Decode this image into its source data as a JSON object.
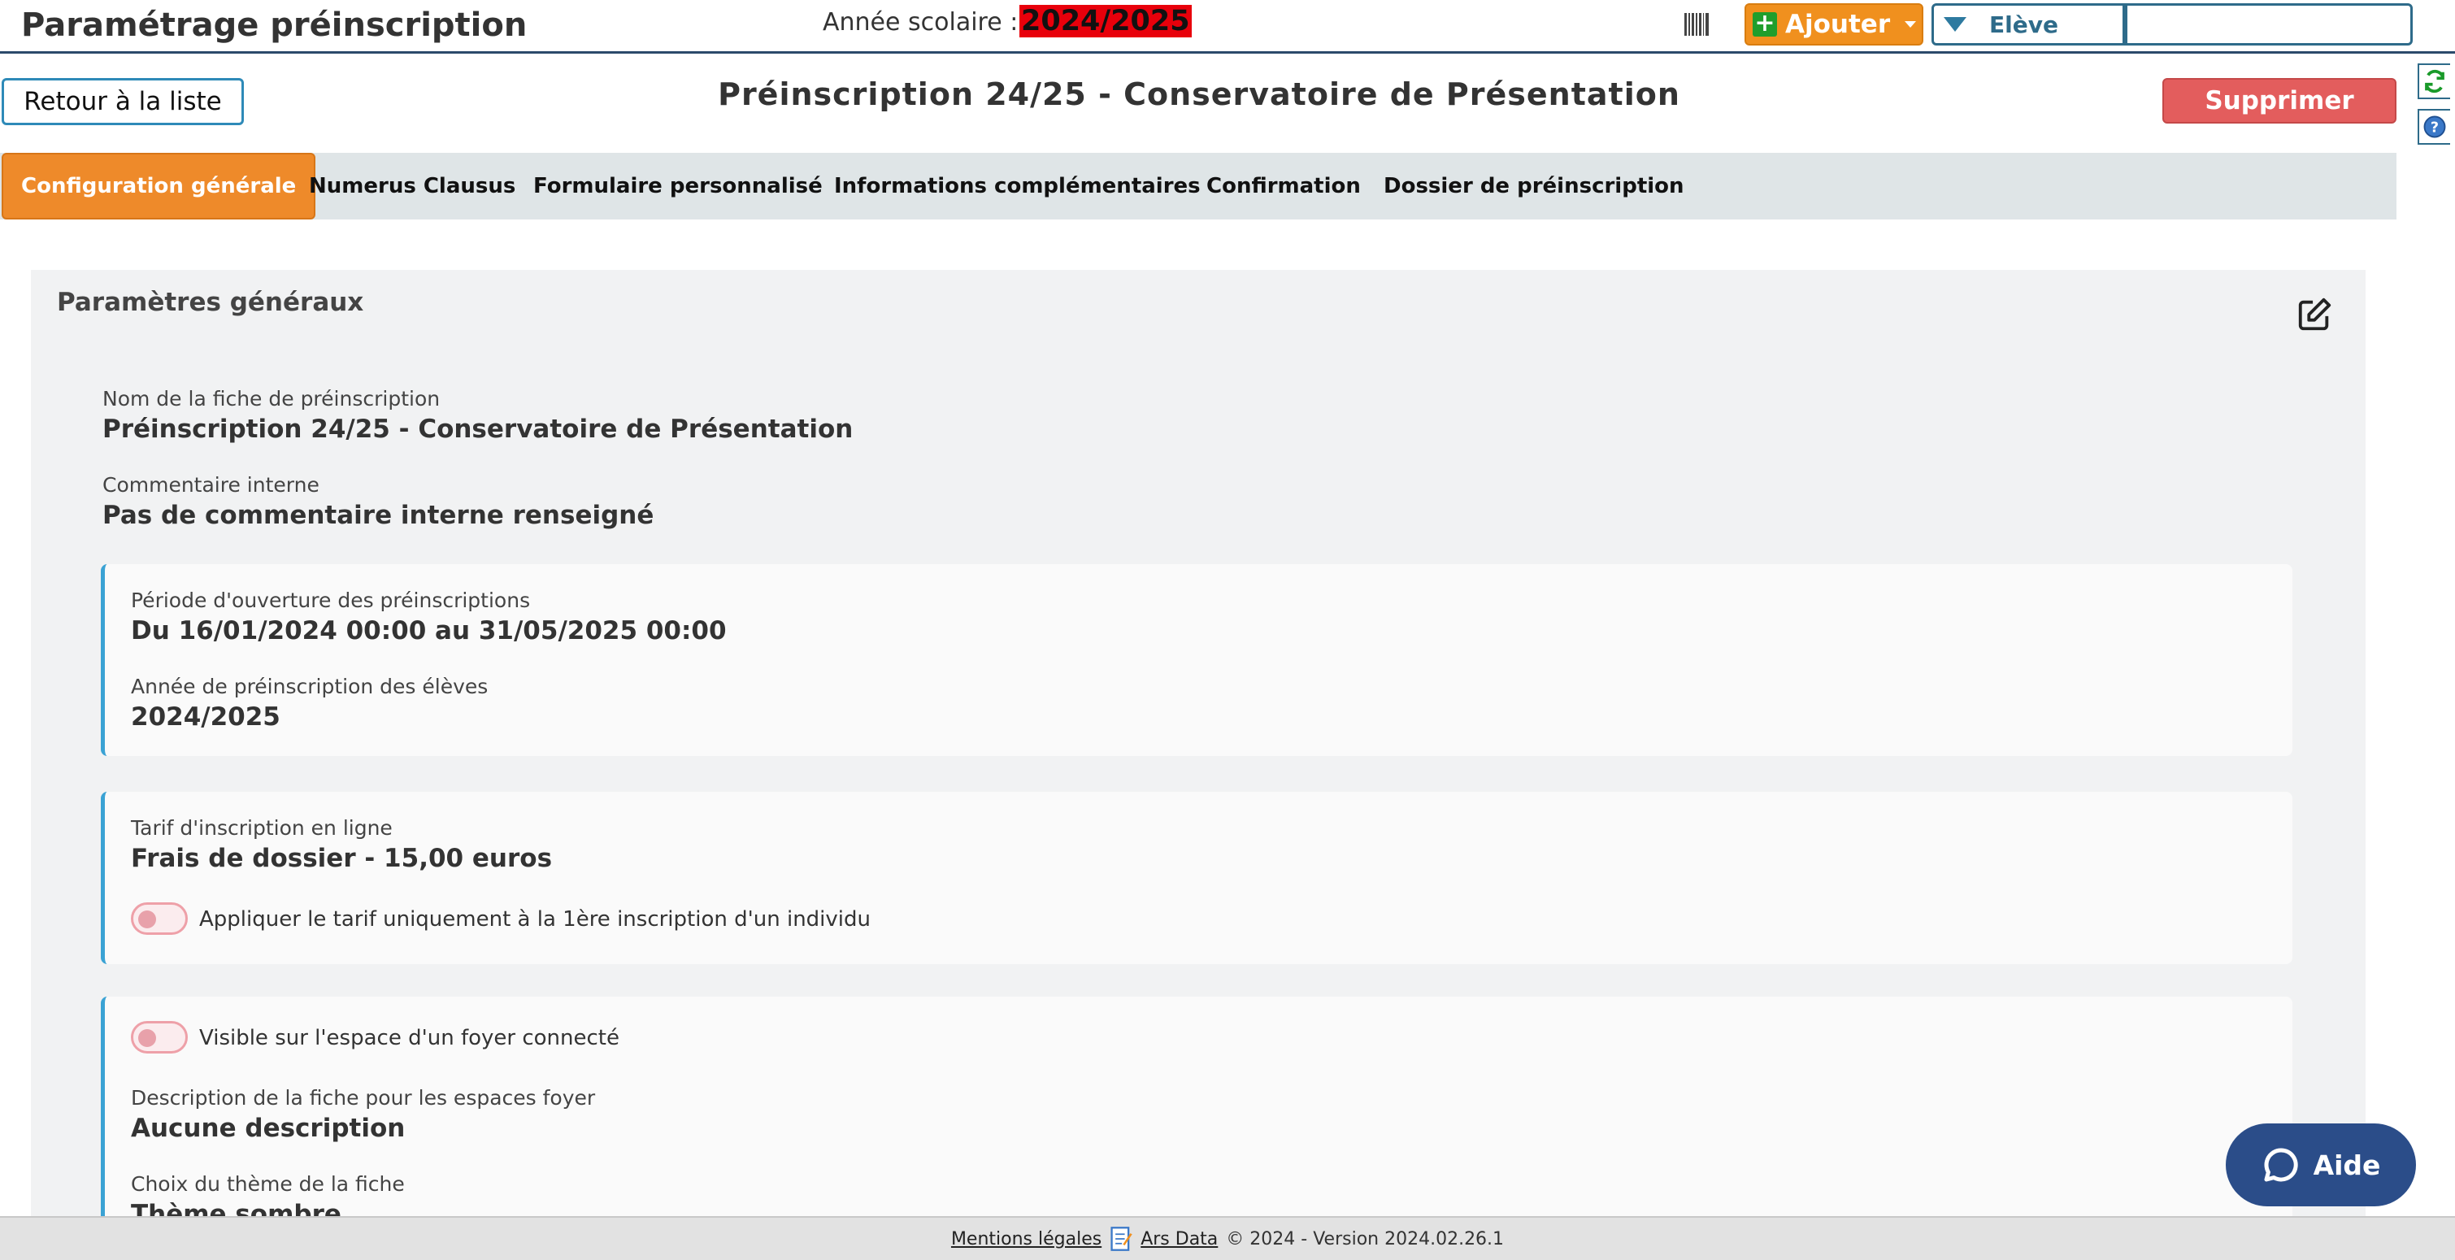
{
  "header": {
    "app_title": "Paramétrage préinscription",
    "year_label": "Année scolaire :",
    "year_value": "2024/2025",
    "add_label": "Ajouter",
    "search_type": "Elève",
    "search_value": ""
  },
  "toolbar": {
    "back_label": "Retour à la liste",
    "page_title": "Préinscription 24/25 - Conservatoire de Présentation",
    "delete_label": "Supprimer"
  },
  "tabs": [
    {
      "label": "Configuration générale",
      "active": true
    },
    {
      "label": "Numerus Clausus",
      "active": false
    },
    {
      "label": "Formulaire personnalisé",
      "active": false
    },
    {
      "label": "Informations complémentaires",
      "active": false
    },
    {
      "label": "Confirmation",
      "active": false
    },
    {
      "label": "Dossier de préinscription",
      "active": false
    }
  ],
  "panel": {
    "title": "Paramètres généraux",
    "name_label": "Nom de la fiche de préinscription",
    "name_value": "Préinscription 24/25 - Conservatoire de Présentation",
    "comment_label": "Commentaire interne",
    "comment_value": "Pas de commentaire interne renseigné",
    "period_label": "Période d'ouverture des préinscriptions",
    "period_value": "Du 16/01/2024 00:00 au 31/05/2025 00:00",
    "student_year_label": "Année de préinscription des élèves",
    "student_year_value": "2024/2025",
    "fee_label": "Tarif d'inscription en ligne",
    "fee_value": "Frais de dossier - 15,00 euros",
    "fee_toggle_label": "Appliquer le tarif uniquement à la 1ère inscription d'un individu",
    "fee_toggle_on": false,
    "visible_toggle_label": "Visible sur l'espace d'un foyer connecté",
    "visible_toggle_on": false,
    "description_label": "Description de la fiche pour les espaces foyer",
    "description_value": "Aucune description",
    "theme_label": "Choix du thème de la fiche",
    "theme_value": "Thème sombre"
  },
  "footer": {
    "legal_link": "Mentions légales",
    "company_link": "Ars Data",
    "copyright": "© 2024 - Version 2024.02.26.1"
  },
  "help_button": {
    "label": "Aide"
  },
  "colors": {
    "accent_orange": "#ee8a2a",
    "year_highlight": "#e8000b",
    "delete_red": "#e35d5d",
    "card_border_blue": "#3aa2d4",
    "help_navy": "#2b4d89"
  }
}
